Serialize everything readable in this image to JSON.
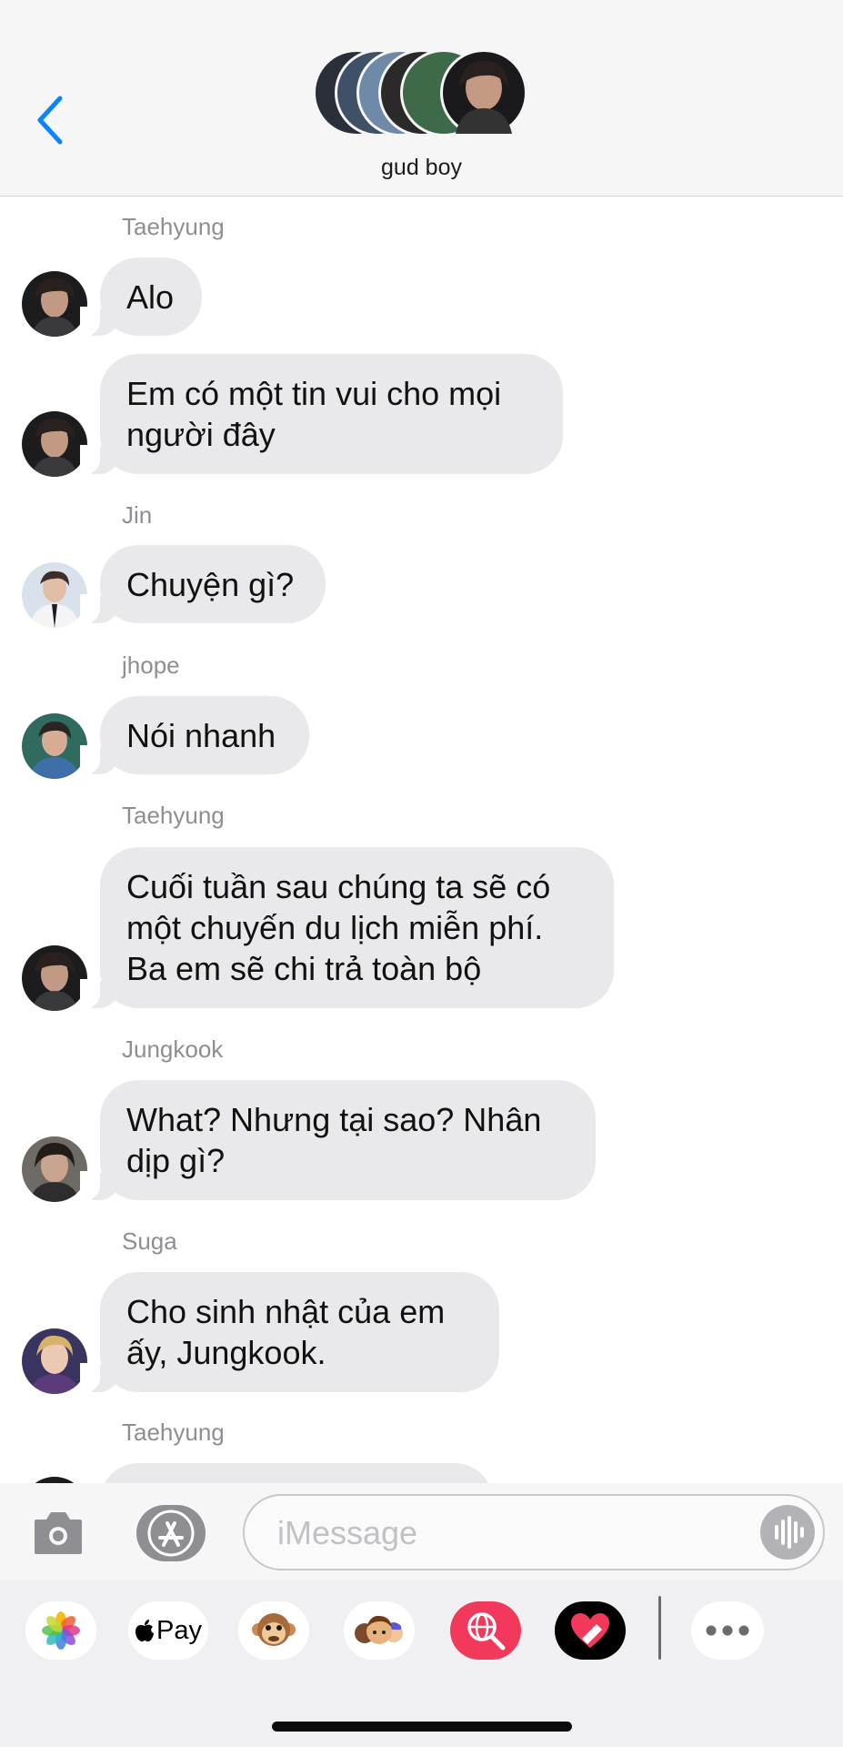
{
  "header": {
    "group_name": "gud boy"
  },
  "messages": [
    {
      "sender": "Taehyung",
      "text": "Alo",
      "avatar": "taehyung"
    },
    {
      "sender": "",
      "text": "Em có một tin vui cho mọi người đây",
      "avatar": "taehyung"
    },
    {
      "sender": "Jin",
      "text": "Chuyện gì?",
      "avatar": "jin"
    },
    {
      "sender": "jhope",
      "text": "Nói nhanh",
      "avatar": "jhope"
    },
    {
      "sender": "Taehyung",
      "text": "Cuối tuần sau chúng ta sẽ có một chuyến du lịch miễn phí. Ba em sẽ chi trả toàn bộ",
      "avatar": "taehyung"
    },
    {
      "sender": "Jungkook",
      "text": "What? Nhưng tại sao? Nhân dịp gì?",
      "avatar": "jungkook"
    },
    {
      "sender": "Suga",
      "text": "Cho sinh nhật của em ấy, Jungkook.",
      "avatar": "suga"
    },
    {
      "sender": "Taehyung",
      "text": "",
      "avatar": "taehyung"
    }
  ],
  "input_bar": {
    "placeholder": "iMessage"
  },
  "apps": {
    "photos": "photos-icon",
    "apple_pay_label": "Pay",
    "animoji": "monkey-icon",
    "memoji": "memoji-icon",
    "search": "globe-search-icon",
    "digital_touch": "heart-icon",
    "more": "more-icon"
  },
  "colors": {
    "accent": "#0a84ff",
    "bubble": "#e9e9eb",
    "sender": "#8e8e93",
    "search_chip": "#f2395b"
  }
}
